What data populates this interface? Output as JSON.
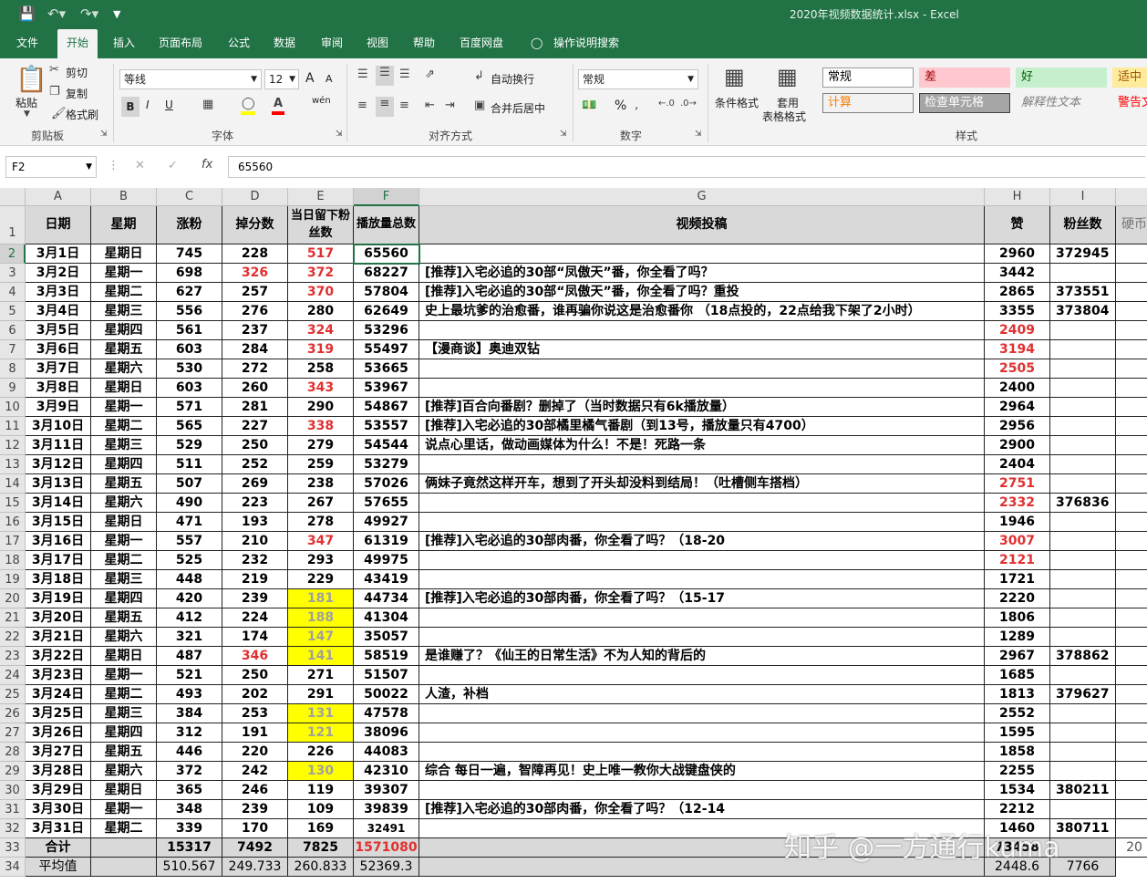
{
  "window": {
    "title": "2020年视频数据统计.xlsx  -  Excel"
  },
  "menu_tabs": [
    "文件",
    "开始",
    "插入",
    "页面布局",
    "公式",
    "数据",
    "审阅",
    "视图",
    "帮助",
    "百度网盘"
  ],
  "tell_me": "操作说明搜索",
  "ribbon": {
    "clipboard": {
      "paste": "粘贴",
      "cut": "剪切",
      "copy": "复制",
      "format_painter": "格式刷",
      "label": "剪贴板"
    },
    "font": {
      "name": "等线",
      "size": "12",
      "label": "字体",
      "bold": "B",
      "italic": "I",
      "underline": "U",
      "grow": "A",
      "shrink": "A",
      "wen": "wén"
    },
    "alignment": {
      "wrap": "自动换行",
      "merge": "合并后居中",
      "label": "对齐方式"
    },
    "number": {
      "format": "常规",
      "label": "数字",
      "percent": "%"
    },
    "styles": {
      "conditional": "条件格式",
      "table1": "套用",
      "table2": "表格格式",
      "label": "样式",
      "boxes": [
        {
          "text": "常规",
          "bg": "#ffffff",
          "fg": "#000000",
          "border": "#9a9a9a"
        },
        {
          "text": "差",
          "bg": "#ffc7ce",
          "fg": "#9c0006",
          "border": "#ffc7ce"
        },
        {
          "text": "好",
          "bg": "#c6efce",
          "fg": "#006100",
          "border": "#c6efce"
        },
        {
          "text": "适中",
          "bg": "#ffeb9c",
          "fg": "#9c5700",
          "border": "#ffeb9c"
        },
        {
          "text": "计算",
          "bg": "#f2f2f2",
          "fg": "#fa7d00",
          "border": "#7f7f7f"
        },
        {
          "text": "检查单元格",
          "bg": "#a5a5a5",
          "fg": "#ffffff",
          "border": "#3f3f3f"
        },
        {
          "text": "解释性文本",
          "bg": "transparent",
          "fg": "#7f7f7f",
          "border": "transparent"
        },
        {
          "text": "警告文",
          "bg": "transparent",
          "fg": "#ff0000",
          "border": "transparent"
        }
      ]
    }
  },
  "formula_bar": {
    "name_box": "F2",
    "fx": "fx",
    "value": "65560"
  },
  "columns": [
    "A",
    "B",
    "C",
    "D",
    "E",
    "F",
    "G",
    "H",
    "I"
  ],
  "header_row": [
    "日期",
    "星期",
    "涨粉",
    "掉分数",
    "当日留下粉丝数",
    "播放量总数",
    "视频投稿",
    "赞",
    "粉丝数",
    "硬币"
  ],
  "rows": [
    [
      "3月1日",
      "星期日",
      "745",
      "228",
      "517",
      "65560",
      "",
      "2960",
      "372945"
    ],
    [
      "3月2日",
      "星期一",
      "698",
      "326",
      "372",
      "68227",
      "[推荐]入宅必追的30部“凤傲天”番，你全看了吗？",
      "3442",
      ""
    ],
    [
      "3月3日",
      "星期二",
      "627",
      "257",
      "370",
      "57804",
      "[推荐]入宅必追的30部“凤傲天”番，你全看了吗？重投",
      "2865",
      "373551"
    ],
    [
      "3月4日",
      "星期三",
      "556",
      "276",
      "280",
      "62649",
      "史上最坑爹的治愈番，谁再骗你说这是治愈番你 （18点投的，22点给我下架了2小时）",
      "3355",
      "373804"
    ],
    [
      "3月5日",
      "星期四",
      "561",
      "237",
      "324",
      "53296",
      "",
      "2409",
      ""
    ],
    [
      "3月6日",
      "星期五",
      "603",
      "284",
      "319",
      "55497",
      "【漫商谈】奥迪双钻",
      "3194",
      ""
    ],
    [
      "3月7日",
      "星期六",
      "530",
      "272",
      "258",
      "53665",
      "",
      "2505",
      ""
    ],
    [
      "3月8日",
      "星期日",
      "603",
      "260",
      "343",
      "53967",
      "",
      "2400",
      ""
    ],
    [
      "3月9日",
      "星期一",
      "571",
      "281",
      "290",
      "54867",
      "[推荐]百合向番剧？删掉了（当时数据只有6k播放量）",
      "2964",
      ""
    ],
    [
      "3月10日",
      "星期二",
      "565",
      "227",
      "338",
      "53557",
      "[推荐]入宅必追的30部橘里橘气番剧（到13号，播放量只有4700）",
      "2956",
      ""
    ],
    [
      "3月11日",
      "星期三",
      "529",
      "250",
      "279",
      "54544",
      "说点心里话，做动画媒体为什么！不是！死路一条",
      "2900",
      ""
    ],
    [
      "3月12日",
      "星期四",
      "511",
      "252",
      "259",
      "53279",
      "",
      "2404",
      ""
    ],
    [
      "3月13日",
      "星期五",
      "507",
      "269",
      "238",
      "57026",
      "俩妹子竟然这样开车，想到了开头却没料到结局！（吐槽侧车搭档）",
      "2751",
      ""
    ],
    [
      "3月14日",
      "星期六",
      "490",
      "223",
      "267",
      "57655",
      "",
      "2332",
      "376836"
    ],
    [
      "3月15日",
      "星期日",
      "471",
      "193",
      "278",
      "49927",
      "",
      "1946",
      ""
    ],
    [
      "3月16日",
      "星期一",
      "557",
      "210",
      "347",
      "61319",
      "[推荐]入宅必追的30部肉番，你全看了吗？（18-20",
      "3007",
      ""
    ],
    [
      "3月17日",
      "星期二",
      "525",
      "232",
      "293",
      "49975",
      "",
      "2121",
      ""
    ],
    [
      "3月18日",
      "星期三",
      "448",
      "219",
      "229",
      "43419",
      "",
      "1721",
      ""
    ],
    [
      "3月19日",
      "星期四",
      "420",
      "239",
      "181",
      "44734",
      "[推荐]入宅必追的30部肉番，你全看了吗？（15-17",
      "2220",
      ""
    ],
    [
      "3月20日",
      "星期五",
      "412",
      "224",
      "188",
      "41304",
      "",
      "1806",
      ""
    ],
    [
      "3月21日",
      "星期六",
      "321",
      "174",
      "147",
      "35057",
      "",
      "1289",
      ""
    ],
    [
      "3月22日",
      "星期日",
      "487",
      "346",
      "141",
      "58519",
      "是谁赚了？《仙王的日常生活》不为人知的背后的",
      "2967",
      "378862"
    ],
    [
      "3月23日",
      "星期一",
      "521",
      "250",
      "271",
      "51507",
      "",
      "1685",
      ""
    ],
    [
      "3月24日",
      "星期二",
      "493",
      "202",
      "291",
      "50022",
      "人渣，补档",
      "1813",
      "379627"
    ],
    [
      "3月25日",
      "星期三",
      "384",
      "253",
      "131",
      "47578",
      "",
      "2552",
      ""
    ],
    [
      "3月26日",
      "星期四",
      "312",
      "191",
      "121",
      "38096",
      "",
      "1595",
      ""
    ],
    [
      "3月27日",
      "星期五",
      "446",
      "220",
      "226",
      "44083",
      "",
      "1858",
      ""
    ],
    [
      "3月28日",
      "星期六",
      "372",
      "242",
      "130",
      "42310",
      "综合 每日一遍，智障再见！史上唯一教你大战键盘侠的",
      "2255",
      ""
    ],
    [
      "3月29日",
      "星期日",
      "365",
      "246",
      "119",
      "39307",
      "",
      "1534",
      "380211"
    ],
    [
      "3月30日",
      "星期一",
      "348",
      "239",
      "109",
      "39839",
      "[推荐]入宅必追的30部肉番，你全看了吗？（12-14",
      "2212",
      ""
    ],
    [
      "3月31日",
      "星期二",
      "339",
      "170",
      "169",
      "32491",
      "",
      "1460",
      "380711"
    ]
  ],
  "red_cells": [
    "2:E",
    "3:D",
    "3:E",
    "4:E",
    "6:E",
    "7:E",
    "9:E",
    "11:E",
    "17:E",
    "23:D",
    "6:H",
    "7:H",
    "8:H",
    "14:H",
    "15:H",
    "17:H",
    "18:H",
    "33:F"
  ],
  "yellow_cells": [
    "20:E",
    "21:E",
    "22:E",
    "23:E",
    "26:E",
    "27:E",
    "29:E"
  ],
  "total_row": {
    "label": "合计",
    "C": "15317",
    "D": "7492",
    "E": "7825",
    "F": "1571080",
    "H": "73458",
    "J": "20"
  },
  "avg_row": {
    "label": "平均值",
    "C": "510.567",
    "D": "249.733",
    "E": "260.833",
    "F": "52369.3",
    "H": "2448.6",
    "I": "7766"
  },
  "watermark": "知乎 @一方通行kuma"
}
